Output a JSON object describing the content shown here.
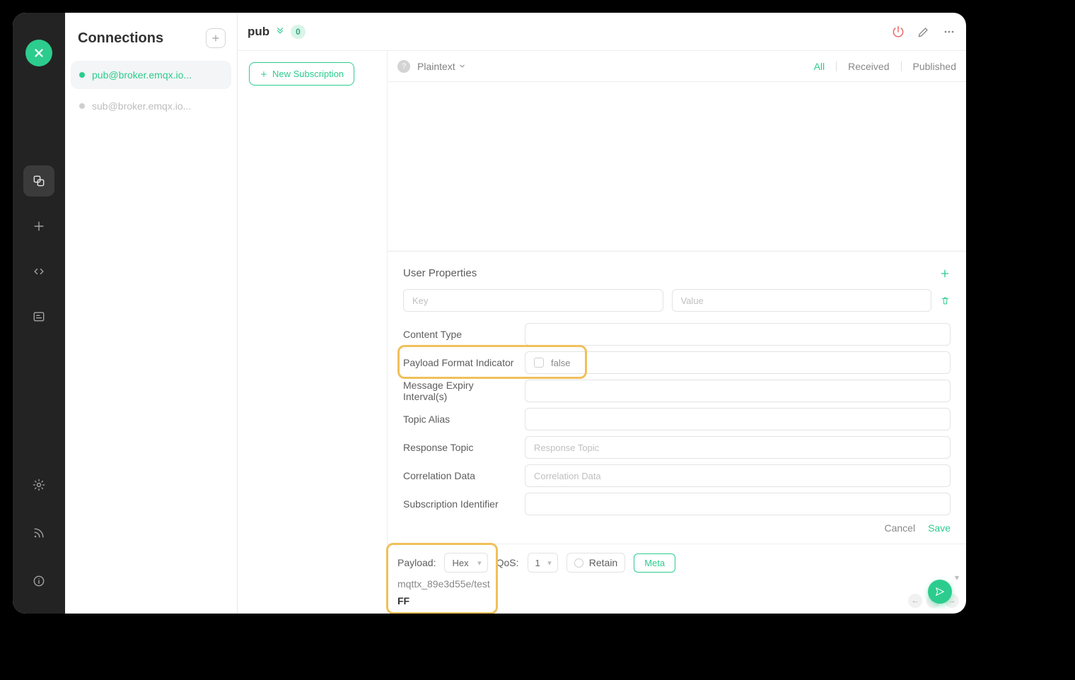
{
  "sidebar": {
    "title": "Connections",
    "items": [
      {
        "name": "pub@broker.emqx.io...",
        "active": true
      },
      {
        "name": "sub@broker.emqx.io...",
        "active": false
      }
    ]
  },
  "header": {
    "tab_title": "pub",
    "badge": "0"
  },
  "subscriptions": {
    "new_btn": "New Subscription"
  },
  "filter": {
    "format": "Plaintext",
    "tabs": {
      "all": "All",
      "received": "Received",
      "published": "Published"
    }
  },
  "meta": {
    "heading": "User Properties",
    "key_placeholder": "Key",
    "value_placeholder": "Value",
    "labels": {
      "content_type": "Content Type",
      "pfi": "Payload Format Indicator",
      "pfi_value": "false",
      "mei": "Message Expiry Interval(s)",
      "topic_alias": "Topic Alias",
      "resp_topic": "Response Topic",
      "resp_topic_placeholder": "Response Topic",
      "corr_data": "Correlation Data",
      "corr_data_placeholder": "Correlation Data",
      "sub_id": "Subscription Identifier"
    },
    "actions": {
      "cancel": "Cancel",
      "save": "Save"
    }
  },
  "publish": {
    "payload_label": "Payload:",
    "format_value": "Hex",
    "qos_label": "QoS:",
    "qos_value": "1",
    "retain_label": "Retain",
    "meta_btn": "Meta",
    "topic": "mqttx_89e3d55e/test",
    "payload": "FF"
  }
}
